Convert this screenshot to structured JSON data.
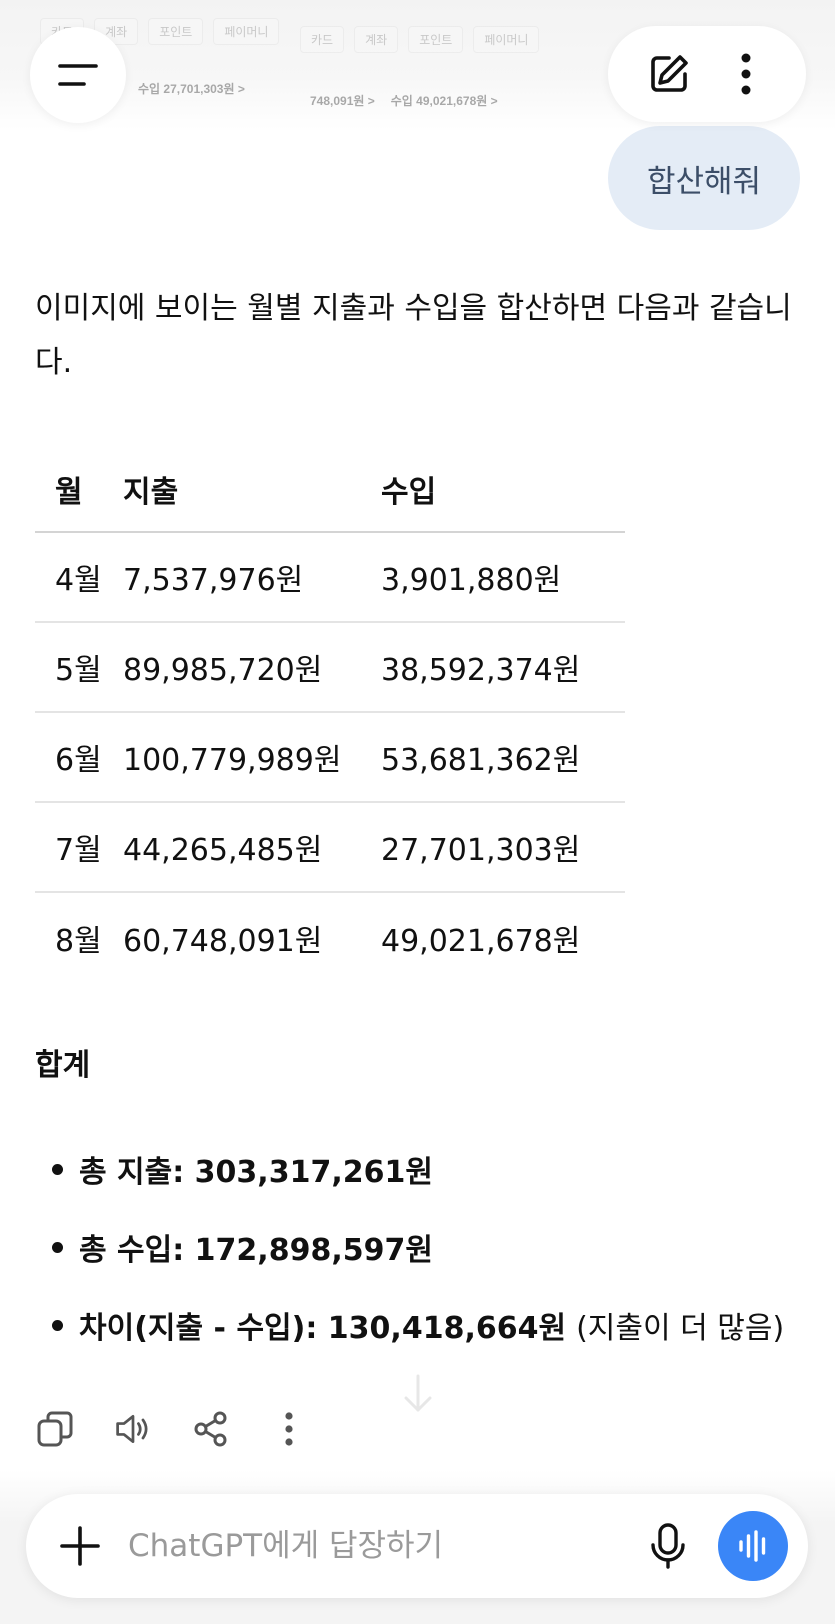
{
  "attachment_preview": {
    "tabs_left": [
      "카드",
      "계좌",
      "포인트",
      "페이머니"
    ],
    "tabs_right": [
      "카드",
      "계좌",
      "포인트",
      "페이머니"
    ],
    "line_left": "수입 27,701,303원 >",
    "line_right_1": "748,091원 >",
    "line_right_2": "수입 49,021,678원 >"
  },
  "header": {
    "menu_icon": "hamburger-icon",
    "new_chat_icon": "edit-icon",
    "more_icon": "more-vertical-icon"
  },
  "user_message": "합산해줘",
  "assistant": {
    "intro": "이미지에 보이는 월별 지출과 수입을 합산하면 다음과 같습니다.",
    "table": {
      "headers": [
        "월",
        "지출",
        "수입"
      ],
      "rows": [
        [
          "4월",
          "7,537,976원",
          "3,901,880원"
        ],
        [
          "5월",
          "89,985,720원",
          "38,592,374원"
        ],
        [
          "6월",
          "100,779,989원",
          "53,681,362원"
        ],
        [
          "7월",
          "44,265,485원",
          "27,701,303원"
        ],
        [
          "8월",
          "60,748,091원",
          "49,021,678원"
        ]
      ]
    },
    "total_heading": "합계",
    "totals": [
      {
        "label": "총 지출: 303,317,261원",
        "note": ""
      },
      {
        "label": "총 수입: 172,898,597원",
        "note": ""
      },
      {
        "label": "차이(지출 - 수입): 130,418,664원",
        "note": "(지출이 더 많음)"
      }
    ]
  },
  "actions": [
    "copy-icon",
    "speaker-icon",
    "share-icon",
    "more-vertical-icon"
  ],
  "composer": {
    "placeholder": "ChatGPT에게 답장하기",
    "accent": "#3a86f7"
  }
}
